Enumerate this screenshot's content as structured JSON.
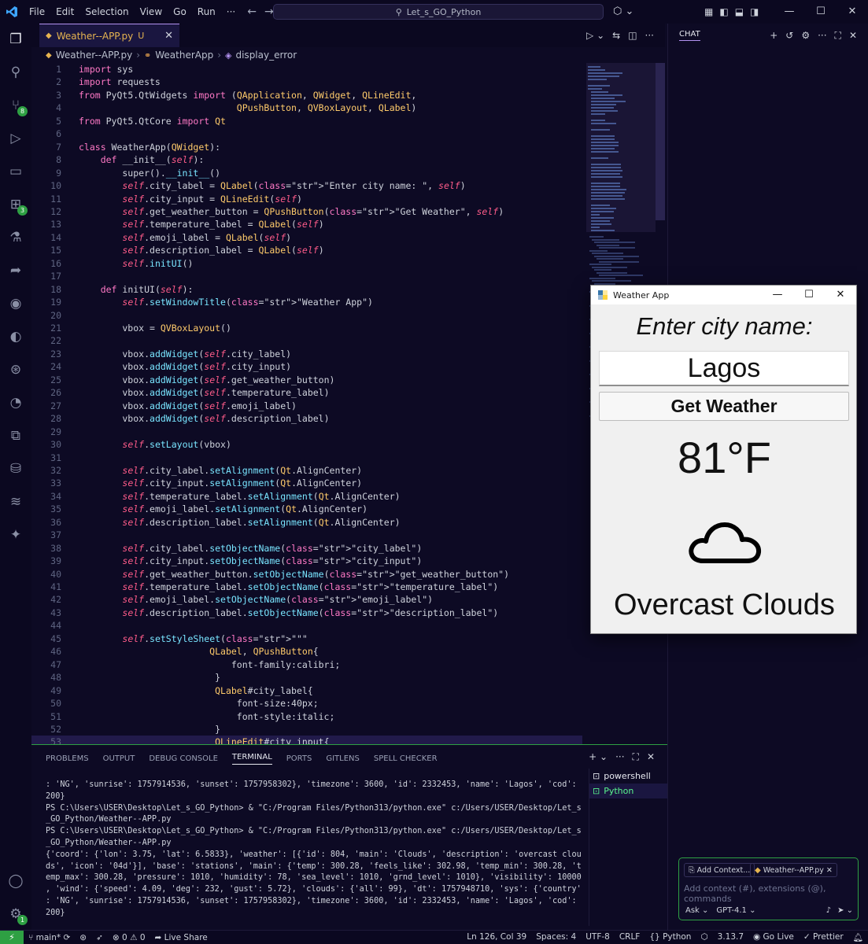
{
  "menu": [
    "File",
    "Edit",
    "Selection",
    "View",
    "Go",
    "Run",
    "···"
  ],
  "search": {
    "text": "Let_s_GO_Python"
  },
  "window_controls": {
    "minimize": "—",
    "maximize": "☐",
    "close": "✕"
  },
  "activity": {
    "scm_badge": "8",
    "ext_badge": "3",
    "settings_badge": "1"
  },
  "tab": {
    "name": "Weather--APP.py",
    "status": "U"
  },
  "breadcrumb": {
    "file": "Weather--APP.py",
    "class": "WeatherApp",
    "method": "display_error"
  },
  "code_lines": [
    {
      "n": "1",
      "t": "import sys"
    },
    {
      "n": "2",
      "t": "import requests"
    },
    {
      "n": "3",
      "t": "from PyQt5.QtWidgets import (QApplication, QWidget, QLineEdit,"
    },
    {
      "n": "4",
      "t": "                             QPushButton, QVBoxLayout, QLabel)"
    },
    {
      "n": "5",
      "t": "from PyQt5.QtCore import Qt"
    },
    {
      "n": "6",
      "t": ""
    },
    {
      "n": "7",
      "t": "class WeatherApp(QWidget):"
    },
    {
      "n": "8",
      "t": "    def __init__(self):"
    },
    {
      "n": "9",
      "t": "        super().__init__()"
    },
    {
      "n": "10",
      "t": "        self.city_label = QLabel(\"Enter city name: \", self)"
    },
    {
      "n": "11",
      "t": "        self.city_input = QLineEdit(self)"
    },
    {
      "n": "12",
      "t": "        self.get_weather_button = QPushButton(\"Get Weather\", self)"
    },
    {
      "n": "13",
      "t": "        self.temperature_label = QLabel(self)"
    },
    {
      "n": "14",
      "t": "        self.emoji_label = QLabel(self)"
    },
    {
      "n": "15",
      "t": "        self.description_label = QLabel(self)"
    },
    {
      "n": "16",
      "t": "        self.initUI()"
    },
    {
      "n": "17",
      "t": ""
    },
    {
      "n": "18",
      "t": "    def initUI(self):"
    },
    {
      "n": "19",
      "t": "        self.setWindowTitle(\"Weather App\")"
    },
    {
      "n": "20",
      "t": ""
    },
    {
      "n": "21",
      "t": "        vbox = QVBoxLayout()"
    },
    {
      "n": "22",
      "t": ""
    },
    {
      "n": "23",
      "t": "        vbox.addWidget(self.city_label)"
    },
    {
      "n": "24",
      "t": "        vbox.addWidget(self.city_input)"
    },
    {
      "n": "25",
      "t": "        vbox.addWidget(self.get_weather_button)"
    },
    {
      "n": "26",
      "t": "        vbox.addWidget(self.temperature_label)"
    },
    {
      "n": "27",
      "t": "        vbox.addWidget(self.emoji_label)"
    },
    {
      "n": "28",
      "t": "        vbox.addWidget(self.description_label)"
    },
    {
      "n": "29",
      "t": ""
    },
    {
      "n": "30",
      "t": "        self.setLayout(vbox)"
    },
    {
      "n": "31",
      "t": ""
    },
    {
      "n": "32",
      "t": "        self.city_label.setAlignment(Qt.AlignCenter)"
    },
    {
      "n": "33",
      "t": "        self.city_input.setAlignment(Qt.AlignCenter)"
    },
    {
      "n": "34",
      "t": "        self.temperature_label.setAlignment(Qt.AlignCenter)"
    },
    {
      "n": "35",
      "t": "        self.emoji_label.setAlignment(Qt.AlignCenter)"
    },
    {
      "n": "36",
      "t": "        self.description_label.setAlignment(Qt.AlignCenter)"
    },
    {
      "n": "37",
      "t": ""
    },
    {
      "n": "38",
      "t": "        self.city_label.setObjectName(\"city_label\")"
    },
    {
      "n": "39",
      "t": "        self.city_input.setObjectName(\"city_input\")"
    },
    {
      "n": "40",
      "t": "        self.get_weather_button.setObjectName(\"get_weather_button\")"
    },
    {
      "n": "41",
      "t": "        self.temperature_label.setObjectName(\"temperature_label\")"
    },
    {
      "n": "42",
      "t": "        self.emoji_label.setObjectName(\"emoji_label\")"
    },
    {
      "n": "43",
      "t": "        self.description_label.setObjectName(\"description_label\")"
    },
    {
      "n": "44",
      "t": ""
    },
    {
      "n": "45",
      "t": "        self.setStyleSheet(\"\"\""
    },
    {
      "n": "46",
      "t": "                        QLabel, QPushButton{"
    },
    {
      "n": "47",
      "t": "                            font-family:calibri;"
    },
    {
      "n": "48",
      "t": "                         }"
    },
    {
      "n": "49",
      "t": "                         QLabel#city_label{"
    },
    {
      "n": "50",
      "t": "                             font-size:40px;"
    },
    {
      "n": "51",
      "t": "                             font-style:italic;"
    },
    {
      "n": "52",
      "t": "                         }"
    },
    {
      "n": "53",
      "t": "                         QLineEdit#city_input{"
    }
  ],
  "panel": {
    "tabs": [
      "PROBLEMS",
      "OUTPUT",
      "DEBUG CONSOLE",
      "TERMINAL",
      "PORTS",
      "GITLENS",
      "SPELL CHECKER"
    ],
    "active_tab": "TERMINAL",
    "terminals": [
      "powershell",
      "Python"
    ],
    "terminal_lines": [
      ": 'NG', 'sunrise': 1757914536, 'sunset': 1757958302}, 'timezone': 3600, 'id': 2332453, 'name': 'Lagos', 'cod':",
      "200}",
      "PS C:\\Users\\USER\\Desktop\\Let_s_GO_Python> & \"C:/Program Files/Python313/python.exe\" c:/Users/USER/Desktop/Let_s",
      "_GO_Python/Weather--APP.py",
      "PS C:\\Users\\USER\\Desktop\\Let_s_GO_Python> & \"C:/Program Files/Python313/python.exe\" c:/Users/USER/Desktop/Let_s",
      "_GO_Python/Weather--APP.py",
      "{'coord': {'lon': 3.75, 'lat': 6.5833}, 'weather': [{'id': 804, 'main': 'Clouds', 'description': 'overcast clou",
      "ds', 'icon': '04d'}], 'base': 'stations', 'main': {'temp': 300.28, 'feels_like': 302.98, 'temp_min': 300.28, 't",
      "emp_max': 300.28, 'pressure': 1010, 'humidity': 78, 'sea_level': 1010, 'grnd_level': 1010}, 'visibility': 10000",
      ", 'wind': {'speed': 4.09, 'deg': 232, 'gust': 5.72}, 'clouds': {'all': 99}, 'dt': 1757948710, 'sys': {'country'",
      ": 'NG', 'sunrise': 1757914536, 'sunset': 1757958302}, 'timezone': 3600, 'id': 2332453, 'name': 'Lagos', 'cod':",
      "200}"
    ]
  },
  "chat": {
    "title": "CHAT",
    "add_context": "Add Context...",
    "file_chip": "Weather--APP.py",
    "placeholder": "Add context (#), extensions (@), commands",
    "mode": "Ask",
    "model": "GPT-4.1"
  },
  "status": {
    "branch": "main*",
    "problems": "0",
    "warnings": "0",
    "live_share": "Live Share",
    "position": "Ln 126, Col 39",
    "spaces": "Spaces: 4",
    "encoding": "UTF-8",
    "eol": "CRLF",
    "language": "Python",
    "python_version": "3.13.7",
    "go_live": "Go Live",
    "prettier": "Prettier"
  },
  "qt_app": {
    "title": "Weather App",
    "city_label": "Enter city name:",
    "city_input": "Lagos",
    "button": "Get Weather",
    "temperature": "81°F",
    "emoji": "cloud-icon",
    "description": "Overcast Clouds"
  }
}
